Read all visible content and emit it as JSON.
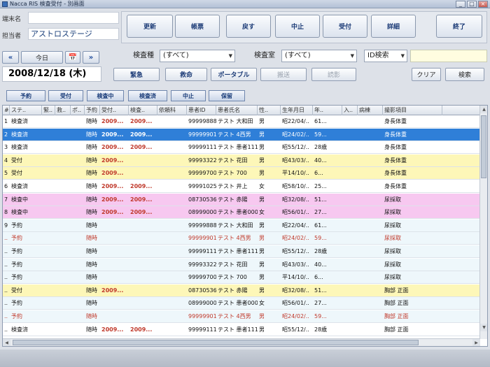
{
  "window": {
    "title": "Nacca RIS 検査受付 - 別画面"
  },
  "info": {
    "terminal_label": "端末名",
    "terminal_value": "",
    "operator_label": "担当者",
    "operator_value": "アストロステージ"
  },
  "commands": [
    "更新",
    "帳票",
    "戻す",
    "中止",
    "受付",
    "詳細",
    "終了"
  ],
  "nav": {
    "prev": "«",
    "today": "今日",
    "calendar": "📅",
    "next": "»",
    "date": "2008/12/18 (木)"
  },
  "filters": {
    "type_label": "検査種",
    "type_value": "(すべて)",
    "room_label": "検査室",
    "room_value": "(すべて)",
    "id_search_value": "ID検索"
  },
  "row_buttons": {
    "urgent": "緊急",
    "ambulance": "救命",
    "portable": "ポータブル",
    "transport": "搬送",
    "read": "読影",
    "clear": "クリア",
    "search": "検索"
  },
  "status_buttons": [
    "予約",
    "受付",
    "検査中",
    "検査済",
    "中止",
    "保留"
  ],
  "columns": [
    "#",
    "ステ..",
    "緊..",
    "救..",
    "ポ..",
    "予約",
    "受付..",
    "検査..",
    "依頼科",
    "患者ID",
    "患者氏名",
    "性..",
    "生年月日",
    "年..",
    "入..",
    "病棟",
    "撮影項目"
  ],
  "rows": [
    {
      "n": "1",
      "status": "検査済",
      "yoyaku": "随時",
      "uke": "2009...",
      "kensa": "2009...",
      "pid": "99999888",
      "name": "テスト 大和田",
      "sex": "男",
      "dob": "昭22/04/..",
      "age": "61...",
      "item": "身長体重",
      "bg": "#ffffff",
      "fg": "#111111",
      "red": true
    },
    {
      "n": "2",
      "status": "検査済",
      "yoyaku": "随時",
      "uke": "2009...",
      "kensa": "2009...",
      "pid": "99999901",
      "name": "テスト 4西男",
      "sex": "男",
      "dob": "昭24/02/..",
      "age": "59...",
      "item": "身長体重",
      "bg": "#2f7fd8",
      "fg": "#ffffff",
      "red": true,
      "selected": true
    },
    {
      "n": "3",
      "status": "検査済",
      "yoyaku": "随時",
      "uke": "2009...",
      "kensa": "2009...",
      "pid": "99999111",
      "name": "テスト 患者111",
      "sex": "男",
      "dob": "昭55/12/..",
      "age": "28歳",
      "item": "身長体重",
      "bg": "#ffffff",
      "fg": "#111111",
      "red": true
    },
    {
      "n": "4",
      "status": "受付",
      "yoyaku": "随時",
      "uke": "2009...",
      "kensa": "",
      "pid": "99993322",
      "name": "テスト 花田",
      "sex": "男",
      "dob": "昭43/03/..",
      "age": "40...",
      "item": "身長体重",
      "bg": "#fdf7b8",
      "fg": "#111111",
      "red": true
    },
    {
      "n": "5",
      "status": "受付",
      "yoyaku": "随時",
      "uke": "2009...",
      "kensa": "",
      "pid": "99999700",
      "name": "テスト 700",
      "sex": "男",
      "dob": "平14/10/..",
      "age": "6...",
      "item": "身長体重",
      "bg": "#fdf7b8",
      "fg": "#111111",
      "red": true
    },
    {
      "n": "6",
      "status": "検査済",
      "yoyaku": "随時",
      "uke": "2009...",
      "kensa": "2009...",
      "pid": "99991025",
      "name": "テスト 井上",
      "sex": "女",
      "dob": "昭58/10/..",
      "age": "25...",
      "item": "身長体重",
      "bg": "#ffffff",
      "fg": "#111111",
      "red": true
    },
    {
      "n": "7",
      "status": "検査中",
      "yoyaku": "随時",
      "uke": "2009...",
      "kensa": "2009...",
      "pid": "08730536",
      "name": "テスト 赤陽",
      "sex": "男",
      "dob": "昭32/08/..",
      "age": "51...",
      "item": "尿採取",
      "bg": "#f7c8f0",
      "fg": "#111111",
      "red": true
    },
    {
      "n": "8",
      "status": "検査中",
      "yoyaku": "随時",
      "uke": "2009...",
      "kensa": "2009...",
      "pid": "08999000",
      "name": "テスト 患者000",
      "sex": "女",
      "dob": "昭56/01/..",
      "age": "27...",
      "item": "尿採取",
      "bg": "#f7c8f0",
      "fg": "#111111",
      "red": true
    },
    {
      "n": "9",
      "status": "予約",
      "yoyaku": "随時",
      "uke": "",
      "kensa": "",
      "pid": "99999888",
      "name": "テスト 大和田",
      "sex": "男",
      "dob": "昭22/04/..",
      "age": "61...",
      "item": "尿採取",
      "bg": "#eef7fb",
      "fg": "#111111",
      "red": false
    },
    {
      "n": "..",
      "status": "予約",
      "yoyaku": "随時",
      "uke": "",
      "kensa": "",
      "pid": "99999901",
      "name": "テスト 4西男",
      "sex": "男",
      "dob": "昭24/02/..",
      "age": "59...",
      "item": "尿採取",
      "bg": "#eef7fb",
      "fg": "#c0392b",
      "red": false
    },
    {
      "n": "..",
      "status": "予約",
      "yoyaku": "随時",
      "uke": "",
      "kensa": "",
      "pid": "99999111",
      "name": "テスト 患者111",
      "sex": "男",
      "dob": "昭55/12/..",
      "age": "28歳",
      "item": "尿採取",
      "bg": "#eef7fb",
      "fg": "#111111",
      "red": false
    },
    {
      "n": "..",
      "status": "予約",
      "yoyaku": "随時",
      "uke": "",
      "kensa": "",
      "pid": "99993322",
      "name": "テスト 花田",
      "sex": "男",
      "dob": "昭43/03/..",
      "age": "40...",
      "item": "尿採取",
      "bg": "#eef7fb",
      "fg": "#111111",
      "red": false
    },
    {
      "n": "..",
      "status": "予約",
      "yoyaku": "随時",
      "uke": "",
      "kensa": "",
      "pid": "99999700",
      "name": "テスト 700",
      "sex": "男",
      "dob": "平14/10/..",
      "age": "6...",
      "item": "尿採取",
      "bg": "#eef7fb",
      "fg": "#111111",
      "red": false
    },
    {
      "n": "..",
      "status": "受付",
      "yoyaku": "随時",
      "uke": "2009...",
      "kensa": "",
      "pid": "08730536",
      "name": "テスト 赤陽",
      "sex": "男",
      "dob": "昭32/08/..",
      "age": "51...",
      "item": "胸部 正面",
      "bg": "#fdf7b8",
      "fg": "#111111",
      "red": true
    },
    {
      "n": "..",
      "status": "予約",
      "yoyaku": "随時",
      "uke": "",
      "kensa": "",
      "pid": "08999000",
      "name": "テスト 患者000",
      "sex": "女",
      "dob": "昭56/01/..",
      "age": "27...",
      "item": "胸部 正面",
      "bg": "#eef7fb",
      "fg": "#111111",
      "red": false
    },
    {
      "n": "..",
      "status": "予約",
      "yoyaku": "随時",
      "uke": "",
      "kensa": "",
      "pid": "99999901",
      "name": "テスト 4西男",
      "sex": "男",
      "dob": "昭24/02/..",
      "age": "59...",
      "item": "胸部 正面",
      "bg": "#eef7fb",
      "fg": "#c0392b",
      "red": false
    },
    {
      "n": "..",
      "status": "検査済",
      "yoyaku": "随時",
      "uke": "2009...",
      "kensa": "2009...",
      "pid": "99999111",
      "name": "テスト 患者111",
      "sex": "男",
      "dob": "昭55/12/..",
      "age": "28歳",
      "item": "胸部 正面",
      "bg": "#ffffff",
      "fg": "#111111",
      "red": true
    }
  ]
}
